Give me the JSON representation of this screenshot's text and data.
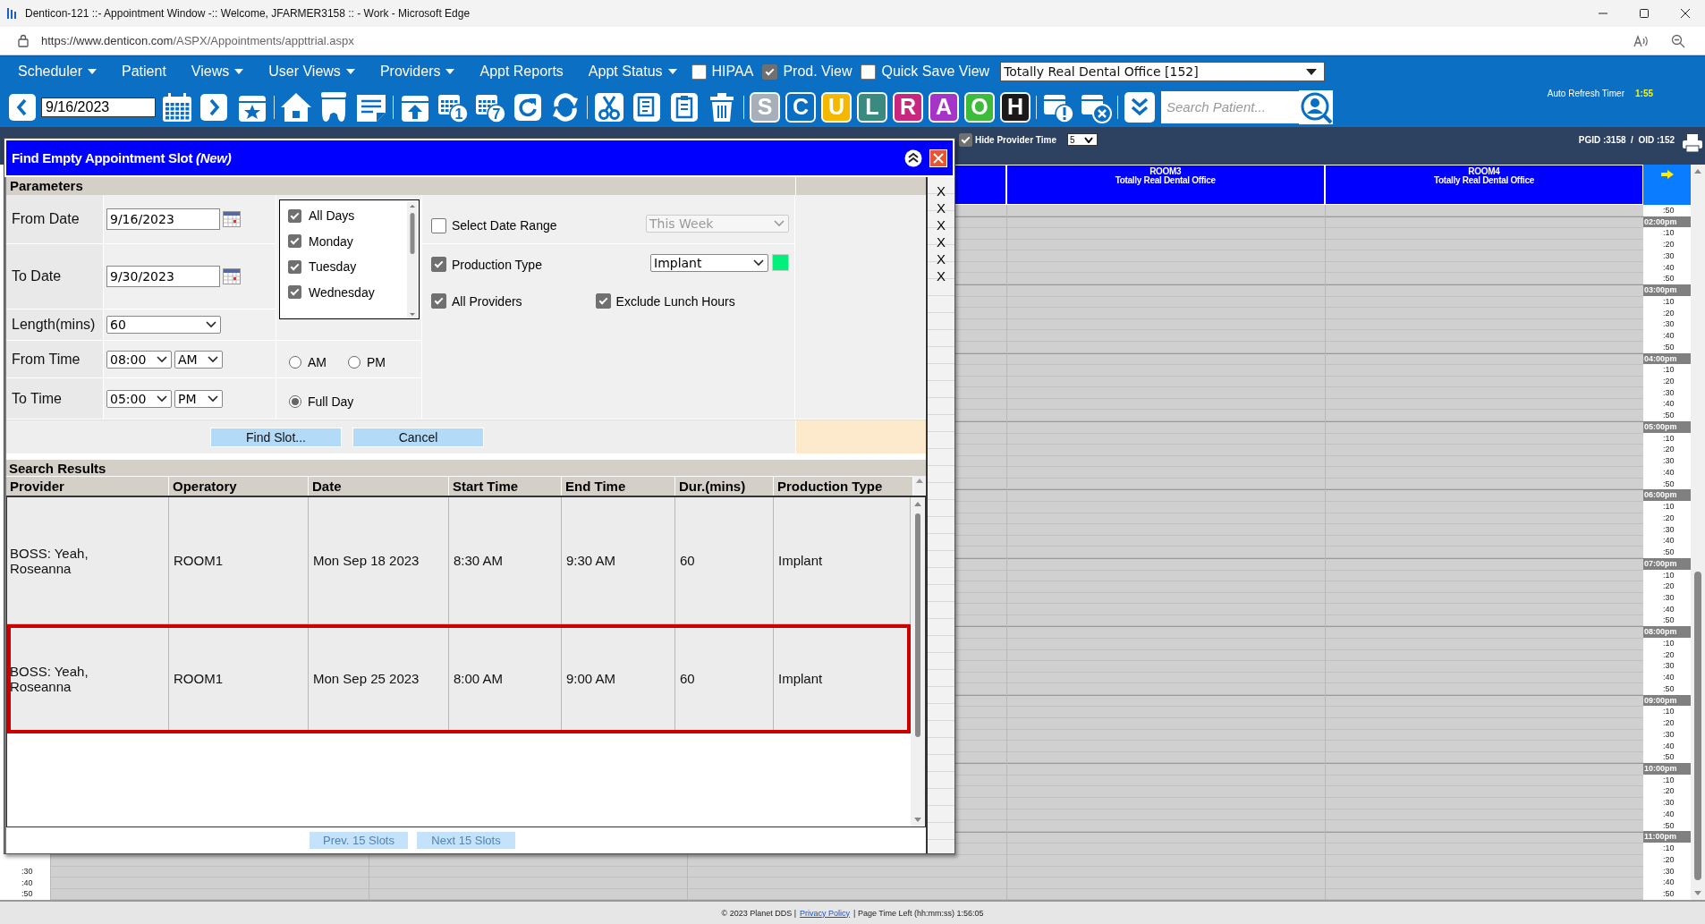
{
  "browser": {
    "title": "Denticon-121 ::- Appointment Window -:: Welcome, JFARMER3158 :: - Work - Microsoft Edge",
    "url_host": "https://www.denticon.com",
    "url_path": "/ASPX/Appointments/appttrial.aspx"
  },
  "menu": [
    {
      "label": "Scheduler",
      "dropdown": true
    },
    {
      "label": "Patient",
      "dropdown": false
    },
    {
      "label": "Views",
      "dropdown": true
    },
    {
      "label": "User Views",
      "dropdown": true
    },
    {
      "label": "Providers",
      "dropdown": true
    },
    {
      "label": "Appt Reports",
      "dropdown": false
    },
    {
      "label": "Appt Status",
      "dropdown": true
    }
  ],
  "menu_checks": [
    {
      "label": "HIPAA",
      "checked": false
    },
    {
      "label": "Prod. View",
      "checked": true
    },
    {
      "label": "Quick Save View",
      "checked": false
    }
  ],
  "office_select": {
    "value": "Totally Real Dental Office [152]"
  },
  "toolbar": [
    {
      "kind": "prev"
    },
    {
      "kind": "date",
      "value": "9/16/2023"
    },
    {
      "kind": "calendar"
    },
    {
      "kind": "next"
    },
    {
      "kind": "calendar-star"
    },
    {
      "kind": "separator"
    },
    {
      "kind": "home"
    },
    {
      "kind": "tooth"
    },
    {
      "kind": "notes"
    },
    {
      "kind": "separator"
    },
    {
      "kind": "calendar-up"
    },
    {
      "kind": "calendar-day",
      "badge": "1"
    },
    {
      "kind": "calendar-day",
      "badge": "7"
    },
    {
      "kind": "refresh"
    },
    {
      "kind": "sync"
    },
    {
      "kind": "separator"
    },
    {
      "kind": "scissors"
    },
    {
      "kind": "copy"
    },
    {
      "kind": "paste"
    },
    {
      "kind": "trash"
    },
    {
      "kind": "separator"
    },
    {
      "kind": "letter",
      "label": "S",
      "color": "#a7b0ba"
    },
    {
      "kind": "letter",
      "label": "C",
      "color": "#0a6fc2"
    },
    {
      "kind": "letter",
      "label": "U",
      "color": "#f5b800"
    },
    {
      "kind": "letter",
      "label": "L",
      "color": "#3b8a7f"
    },
    {
      "kind": "letter",
      "label": "R",
      "color": "#c8267f"
    },
    {
      "kind": "letter",
      "label": "A",
      "color": "#a634c9"
    },
    {
      "kind": "letter",
      "label": "O",
      "color": "#3dbb3a"
    },
    {
      "kind": "letter",
      "label": "H",
      "color": "#1a1a1a"
    },
    {
      "kind": "separator"
    },
    {
      "kind": "calendar-alert"
    },
    {
      "kind": "calendar-x"
    },
    {
      "kind": "separator"
    },
    {
      "kind": "expand"
    },
    {
      "kind": "search",
      "placeholder": "Search Patient..."
    },
    {
      "kind": "patient-search"
    }
  ],
  "auto_refresh": {
    "label": "Auto Refresh Timer",
    "value": "1:55"
  },
  "info_bar": {
    "hide_provider_time": {
      "label": "Hide Provider Time",
      "checked": true
    },
    "interval": "5",
    "ids": "PGID :3158  /  OID :152"
  },
  "calendar": {
    "columns": [
      {
        "title": "ROOM3",
        "subtitle": "Totally Real Dental Office"
      },
      {
        "title": "ROOM4",
        "subtitle": "Totally Real Dental Office"
      }
    ],
    "left_time_labels": [
      ":30",
      ":40",
      ":50"
    ],
    "time_column": {
      "leading": [
        ":50"
      ],
      "hours": [
        {
          "label": "02:00pm",
          "minutes": [
            ":10",
            ":20",
            ":30",
            ":40",
            ":50"
          ]
        },
        {
          "label": "03:00pm",
          "minutes": [
            ":10",
            ":20",
            ":30",
            ":40",
            ":50"
          ]
        },
        {
          "label": "04:00pm",
          "minutes": [
            ":10",
            ":20",
            ":30",
            ":40",
            ":50"
          ]
        },
        {
          "label": "05:00pm",
          "minutes": [
            ":10",
            ":20",
            ":30",
            ":40",
            ":50"
          ]
        },
        {
          "label": "06:00pm",
          "minutes": [
            ":10",
            ":20",
            ":30",
            ":40",
            ":50"
          ]
        },
        {
          "label": "07:00pm",
          "minutes": [
            ":10",
            ":20",
            ":30",
            ":40",
            ":50"
          ]
        },
        {
          "label": "08:00pm",
          "minutes": [
            ":10",
            ":20",
            ":30",
            ":40",
            ":50"
          ]
        },
        {
          "label": "09:00pm",
          "minutes": [
            ":10",
            ":20",
            ":30",
            ":40",
            ":50"
          ]
        },
        {
          "label": "10:00pm",
          "minutes": [
            ":10",
            ":20",
            ":30",
            ":40",
            ":50"
          ]
        },
        {
          "label": "11:00pm",
          "minutes": [
            ":10",
            ":20",
            ":30",
            ":40",
            ":50"
          ]
        }
      ]
    }
  },
  "footer": {
    "copyright": "© 2023 Planet DDS |",
    "link": "Privacy Policy",
    "time_left": "| Page Time Left (hh:mm:ss) 1:56:05"
  },
  "dialog": {
    "title": "Find Empty Appointment Slot *(New)*",
    "parameters_heading": "Parameters",
    "from_date": {
      "label": "From Date",
      "value": "9/16/2023"
    },
    "to_date": {
      "label": "To Date",
      "value": "9/30/2023"
    },
    "length": {
      "label": "Length(mins)",
      "value": "60"
    },
    "from_time": {
      "label": "From Time",
      "time": "08:00",
      "meridiem": "AM"
    },
    "to_time": {
      "label": "To Time",
      "time": "05:00",
      "meridiem": "PM"
    },
    "days": [
      {
        "label": "All Days",
        "checked": true
      },
      {
        "label": "Monday",
        "checked": true
      },
      {
        "label": "Tuesday",
        "checked": true
      },
      {
        "label": "Wednesday",
        "checked": true
      }
    ],
    "time_range": [
      {
        "label": "AM",
        "selected": false
      },
      {
        "label": "PM",
        "selected": false
      },
      {
        "label": "Full Day",
        "selected": true
      }
    ],
    "select_date_range": {
      "label": "Select Date Range",
      "checked": false,
      "value": "This Week",
      "disabled": true
    },
    "production_type": {
      "label": "Production Type",
      "checked": true,
      "value": "Implant",
      "color": "#00f07a"
    },
    "all_providers": {
      "label": "All Providers",
      "checked": true
    },
    "exclude_lunch": {
      "label": "Exclude Lunch Hours",
      "checked": true
    },
    "buttons": [
      {
        "label": "Find Slot..."
      },
      {
        "label": "Cancel"
      }
    ],
    "results_heading": "Search Results",
    "columns": [
      "Provider",
      "Operatory",
      "Date",
      "Start Time",
      "End Time",
      "Dur.(mins)",
      "Production Type"
    ],
    "rows": [
      {
        "cells": [
          "BOSS: Yeah, Roseanna",
          "ROOM1",
          "Mon Sep 18 2023",
          "8:30 AM",
          "9:30 AM",
          "60",
          "Implant"
        ],
        "highlighted": false
      },
      {
        "cells": [
          "BOSS: Yeah, Roseanna",
          "ROOM1",
          "Mon Sep 25 2023",
          "8:00 AM",
          "9:00 AM",
          "60",
          "Implant"
        ],
        "highlighted": true
      }
    ],
    "pager": [
      {
        "label": "Prev. 15 Slots",
        "disabled": true
      },
      {
        "label": "Next 15 Slots",
        "disabled": true
      }
    ],
    "side_marks": [
      "X",
      "X",
      "X",
      "X",
      "X",
      "X"
    ]
  }
}
